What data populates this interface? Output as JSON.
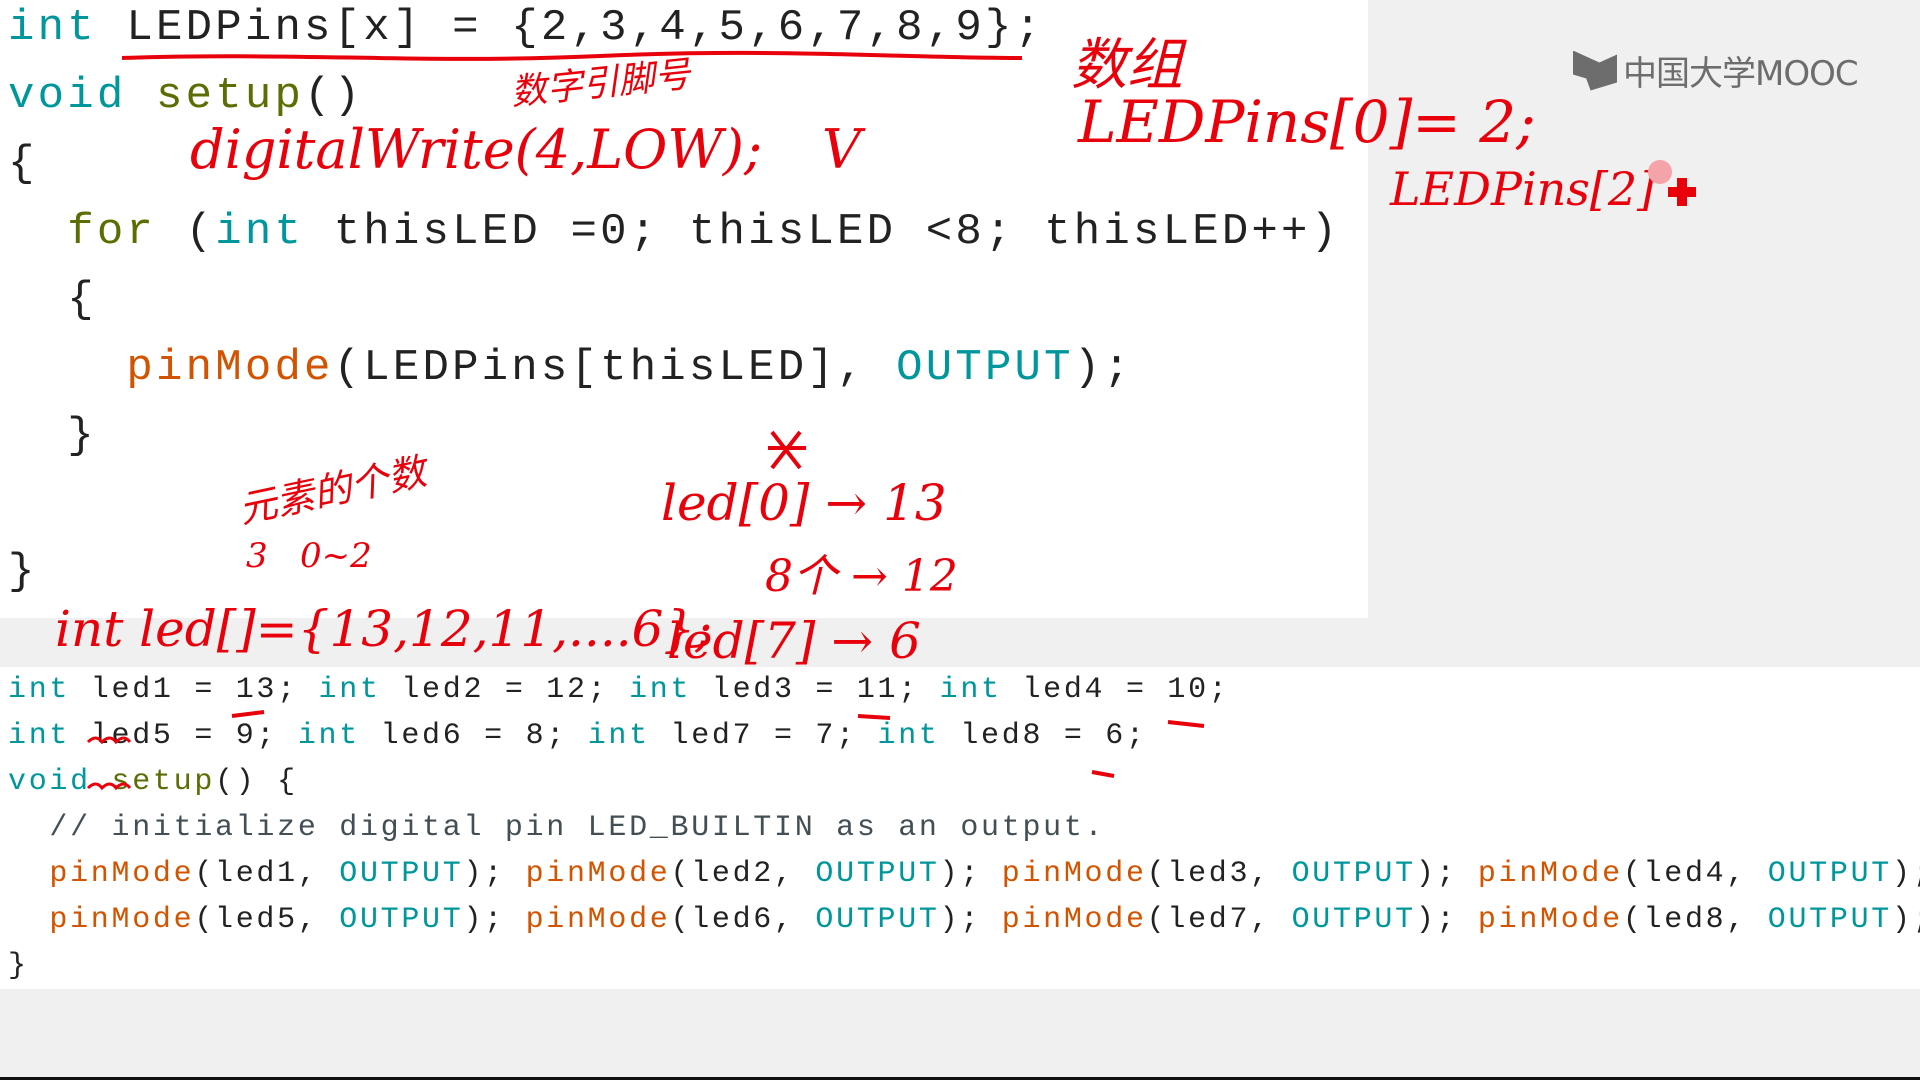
{
  "logo": {
    "text": "中国大学MOOC"
  },
  "top_code": [
    [
      {
        "t": "int",
        "c": "kw"
      },
      {
        "t": " LEDPins[x] = {2,3,4,5,6,7,8,9};",
        "c": "plain"
      }
    ],
    [
      {
        "t": "void",
        "c": "kw"
      },
      {
        "t": " ",
        "c": "plain"
      },
      {
        "t": "setup",
        "c": "fn"
      },
      {
        "t": "()",
        "c": "plain"
      }
    ],
    [
      {
        "t": "{",
        "c": "plain"
      }
    ],
    [
      {
        "t": "  ",
        "c": "plain"
      },
      {
        "t": "for",
        "c": "fn"
      },
      {
        "t": " (",
        "c": "plain"
      },
      {
        "t": "int",
        "c": "kw"
      },
      {
        "t": " thisLED =0; thisLED <8; thisLED++)",
        "c": "plain"
      }
    ],
    [
      {
        "t": "  {",
        "c": "plain"
      }
    ],
    [
      {
        "t": "    ",
        "c": "plain"
      },
      {
        "t": "pinMode",
        "c": "api"
      },
      {
        "t": "(LEDPins[thisLED], ",
        "c": "plain"
      },
      {
        "t": "OUTPUT",
        "c": "const"
      },
      {
        "t": ");",
        "c": "plain"
      }
    ],
    [
      {
        "t": "  }",
        "c": "plain"
      }
    ],
    [],
    [
      {
        "t": "}",
        "c": "plain"
      }
    ]
  ],
  "bottom_code": [
    [
      {
        "t": "int",
        "c": "kw"
      },
      {
        "t": " led1 = 13; ",
        "c": "plain"
      },
      {
        "t": "int",
        "c": "kw"
      },
      {
        "t": " led2 = 12; ",
        "c": "plain"
      },
      {
        "t": "int",
        "c": "kw"
      },
      {
        "t": " led3 = 11; ",
        "c": "plain"
      },
      {
        "t": "int",
        "c": "kw"
      },
      {
        "t": " led4 = 10;",
        "c": "plain"
      }
    ],
    [
      {
        "t": "int",
        "c": "kw"
      },
      {
        "t": " led5 = 9; ",
        "c": "plain"
      },
      {
        "t": "int",
        "c": "kw"
      },
      {
        "t": " led6 = 8; ",
        "c": "plain"
      },
      {
        "t": "int",
        "c": "kw"
      },
      {
        "t": " led7 = 7; ",
        "c": "plain"
      },
      {
        "t": "int",
        "c": "kw"
      },
      {
        "t": " led8 = 6;",
        "c": "plain"
      }
    ],
    [
      {
        "t": "void",
        "c": "kw"
      },
      {
        "t": " ",
        "c": "plain"
      },
      {
        "t": "setup",
        "c": "fn"
      },
      {
        "t": "() {",
        "c": "plain"
      }
    ],
    [
      {
        "t": "  // initialize digital pin LED_BUILTIN as an output.",
        "c": "cmt"
      }
    ],
    [
      {
        "t": "  ",
        "c": "plain"
      },
      {
        "t": "pinMode",
        "c": "api"
      },
      {
        "t": "(led1, ",
        "c": "plain"
      },
      {
        "t": "OUTPUT",
        "c": "const"
      },
      {
        "t": "); ",
        "c": "plain"
      },
      {
        "t": "pinMode",
        "c": "api"
      },
      {
        "t": "(led2, ",
        "c": "plain"
      },
      {
        "t": "OUTPUT",
        "c": "const"
      },
      {
        "t": "); ",
        "c": "plain"
      },
      {
        "t": "pinMode",
        "c": "api"
      },
      {
        "t": "(led3, ",
        "c": "plain"
      },
      {
        "t": "OUTPUT",
        "c": "const"
      },
      {
        "t": "); ",
        "c": "plain"
      },
      {
        "t": "pinMode",
        "c": "api"
      },
      {
        "t": "(led4, ",
        "c": "plain"
      },
      {
        "t": "OUTPUT",
        "c": "const"
      },
      {
        "t": ");",
        "c": "plain"
      }
    ],
    [
      {
        "t": "  ",
        "c": "plain"
      },
      {
        "t": "pinMode",
        "c": "api"
      },
      {
        "t": "(led5, ",
        "c": "plain"
      },
      {
        "t": "OUTPUT",
        "c": "const"
      },
      {
        "t": "); ",
        "c": "plain"
      },
      {
        "t": "pinMode",
        "c": "api"
      },
      {
        "t": "(led6, ",
        "c": "plain"
      },
      {
        "t": "OUTPUT",
        "c": "const"
      },
      {
        "t": "); ",
        "c": "plain"
      },
      {
        "t": "pinMode",
        "c": "api"
      },
      {
        "t": "(led7, ",
        "c": "plain"
      },
      {
        "t": "OUTPUT",
        "c": "const"
      },
      {
        "t": "); ",
        "c": "plain"
      },
      {
        "t": "pinMode",
        "c": "api"
      },
      {
        "t": "(led8, ",
        "c": "plain"
      },
      {
        "t": "OUTPUT",
        "c": "const"
      },
      {
        "t": ");",
        "c": "plain"
      }
    ],
    [
      {
        "t": "}",
        "c": "plain"
      }
    ]
  ],
  "annotations": {
    "array": "数组",
    "pin_number": "数字引脚号",
    "digital_write": "digitalWrite(4,LOW);",
    "check": "V",
    "ledpins_0": "LEDPins[0]= 2;",
    "ledpins_2": "LEDPins[2]",
    "element_count": "元素的个数",
    "count_range": "3   0~2",
    "led_array": "int led[]={13,12,11,....6};",
    "led0": "led[0] → 13",
    "eight": "8个 → 12",
    "led7": "led[7] → 6"
  },
  "colors": {
    "ink": "#e8000b",
    "keyword": "#00979c",
    "function": "#5e6d03",
    "api": "#d35400"
  }
}
